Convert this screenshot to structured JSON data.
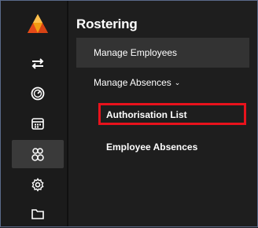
{
  "sidebar": {
    "icons": [
      {
        "name": "swap-arrows-icon"
      },
      {
        "name": "dashboard-gauge-icon"
      },
      {
        "name": "calendar-icon"
      },
      {
        "name": "people-icon"
      },
      {
        "name": "settings-gear-icon"
      },
      {
        "name": "folder-icon"
      }
    ],
    "active_index": 3
  },
  "panel": {
    "title": "Rostering",
    "manage_employees": "Manage Employees",
    "manage_absences": "Manage Absences",
    "manage_absences_chevron": "⌄",
    "authorisation_list": "Authorisation List",
    "employee_absences": "Employee Absences"
  },
  "colors": {
    "background": "#1f1f1f",
    "selected_item": "#333333",
    "highlight_border": "#e8121c",
    "logo_orange": "#f39c12",
    "logo_red": "#e64a19"
  }
}
